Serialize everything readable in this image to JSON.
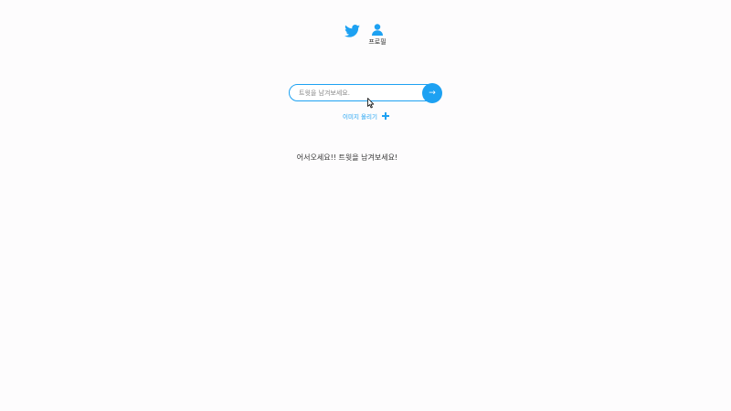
{
  "nav": {
    "home_icon": "twitter-bird-icon",
    "profile_icon": "user-icon",
    "profile_label": "프로필"
  },
  "tweet_form": {
    "placeholder": "트윗을 남겨보세요.",
    "value": "",
    "submit_label": "→"
  },
  "attach": {
    "label": "이미지 올리기",
    "icon": "plus-icon"
  },
  "feed": {
    "empty_message": "어서오세요!! 트윗을 남겨보세요!"
  },
  "colors": {
    "accent": "#1da1f2",
    "background": "#fdfcfd",
    "text": "#333333"
  }
}
